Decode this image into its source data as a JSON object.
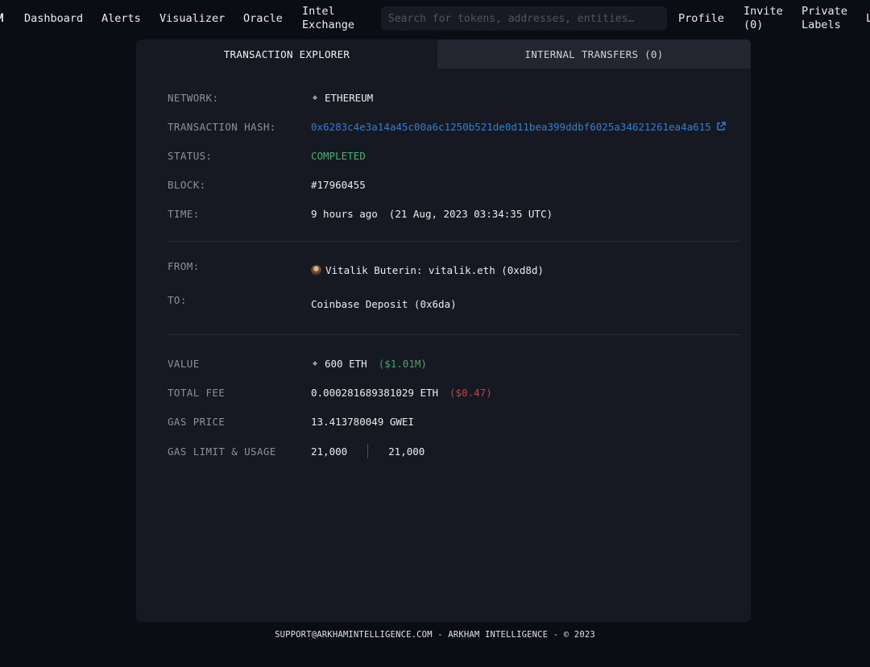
{
  "nav": {
    "logo_fragment": "M",
    "items": [
      {
        "label": "Dashboard"
      },
      {
        "label": "Alerts"
      },
      {
        "label": "Visualizer"
      },
      {
        "label": "Oracle"
      },
      {
        "label": "Intel\nExchange"
      }
    ],
    "search_placeholder": "Search for tokens, addresses, entities…",
    "right_items": [
      {
        "label": "Profile"
      },
      {
        "label": "Invite\n(0)"
      },
      {
        "label": "Private\nLabels"
      },
      {
        "label": "L"
      }
    ]
  },
  "tabs": {
    "explorer": "TRANSACTION EXPLORER",
    "internal": "INTERNAL TRANSFERS (0)"
  },
  "details": {
    "network_label": "NETWORK:",
    "network_value": "ETHEREUM",
    "hash_label": "TRANSACTION HASH:",
    "hash_value": "0x6283c4e3a14a45c00a6c1250b521de0d11bea399ddbf6025a34621261ea4a615",
    "status_label": "STATUS:",
    "status_value": "COMPLETED",
    "block_label": "BLOCK:",
    "block_value": "#17960455",
    "time_label": "TIME:",
    "time_relative": "9 hours ago",
    "time_absolute": "(21 Aug, 2023 03:34:35 UTC)",
    "from_label": "FROM:",
    "from_value": "Vitalik Buterin: vitalik.eth (0xd8d)",
    "to_label": "TO:",
    "to_value": "Coinbase Deposit (0x6da)",
    "value_label": "VALUE",
    "value_amount": "600 ETH",
    "value_usd": "($1.01M)",
    "fee_label": "TOTAL FEE",
    "fee_amount": "0.000281689381029 ETH",
    "fee_usd": "($0.47)",
    "gas_price_label": "GAS PRICE",
    "gas_price_value": "13.413780049 GWEI",
    "gas_limit_label": "GAS LIMIT & USAGE",
    "gas_limit": "21,000",
    "gas_usage": "21,000"
  },
  "footer": {
    "text": "SUPPORT@ARKHAMINTELLIGENCE.COM - ARKHAM INTELLIGENCE - © 2023"
  },
  "colors": {
    "background": "#0b0d14",
    "card": "#161922",
    "link": "#2f7fd6",
    "success": "#3fb76a",
    "danger": "#d04545"
  },
  "icons": {
    "network": "ethereum-icon",
    "value": "ethereum-icon",
    "from": "avatar",
    "hash": "external-link-icon"
  }
}
